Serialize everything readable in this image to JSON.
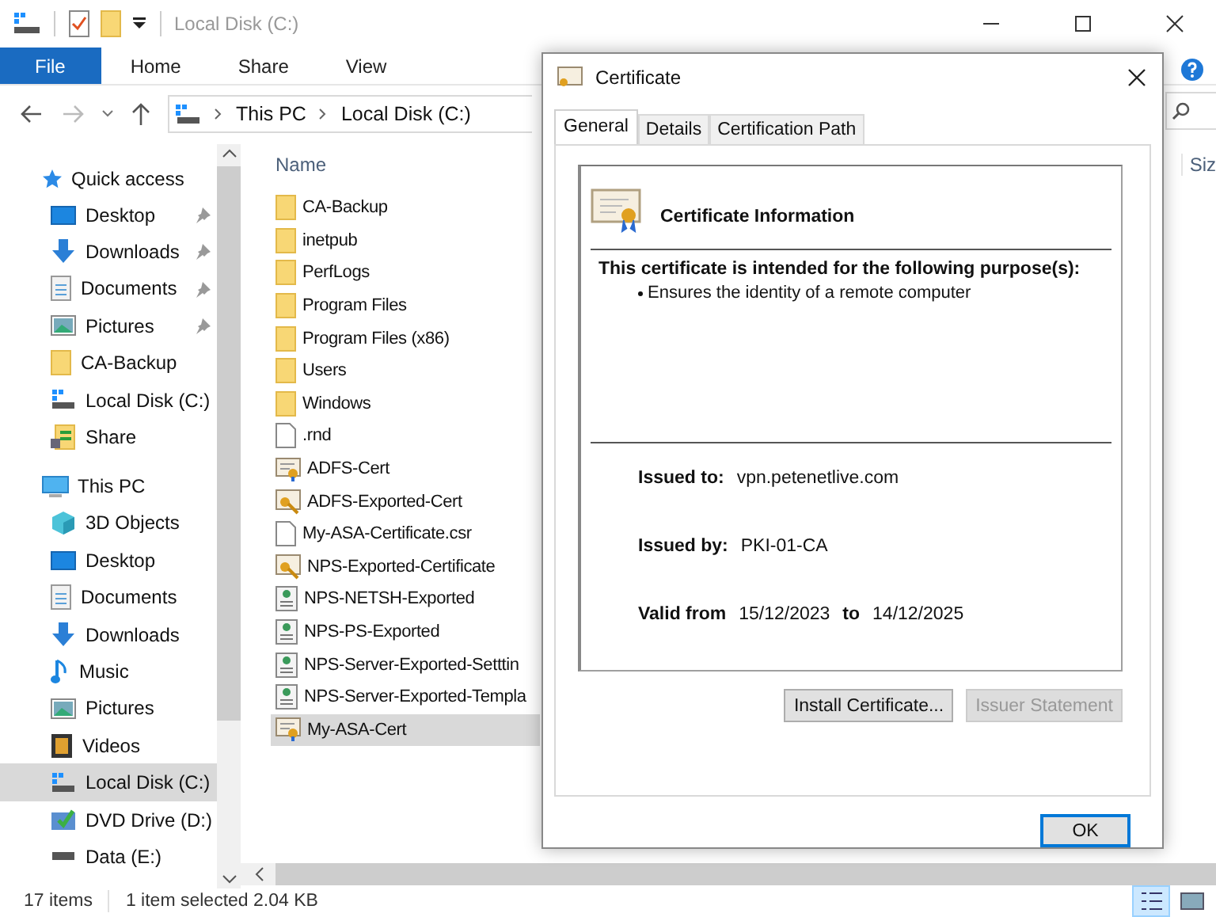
{
  "window": {
    "title": "Local Disk (C:)"
  },
  "ribbon_tabs": [
    {
      "label": "File",
      "selected": true
    },
    {
      "label": "Home",
      "selected": false
    },
    {
      "label": "Share",
      "selected": false
    },
    {
      "label": "View",
      "selected": false
    }
  ],
  "address": {
    "crumbs": [
      "This PC",
      "Local Disk (C:)"
    ]
  },
  "nav": [
    {
      "label": "Quick access",
      "kind": "star",
      "selected": false,
      "children": [
        {
          "label": "Desktop",
          "kind": "desktop",
          "pinned": true,
          "selected": false
        },
        {
          "label": "Downloads",
          "kind": "download",
          "pinned": true,
          "selected": false
        },
        {
          "label": "Documents",
          "kind": "document",
          "pinned": true,
          "selected": false
        },
        {
          "label": "Pictures",
          "kind": "pictures",
          "pinned": true,
          "selected": false
        },
        {
          "label": "CA-Backup",
          "kind": "folder",
          "pinned": false,
          "selected": false
        },
        {
          "label": "Local Disk (C:)",
          "kind": "drive",
          "pinned": false,
          "selected": false
        },
        {
          "label": "Share",
          "kind": "share",
          "pinned": false,
          "selected": false
        }
      ]
    },
    {
      "label": "This PC",
      "kind": "pc",
      "selected": false,
      "children": [
        {
          "label": "3D Objects",
          "kind": "cube",
          "pinned": false,
          "selected": false
        },
        {
          "label": "Desktop",
          "kind": "desktop",
          "pinned": false,
          "selected": false
        },
        {
          "label": "Documents",
          "kind": "document",
          "pinned": false,
          "selected": false
        },
        {
          "label": "Downloads",
          "kind": "download",
          "pinned": false,
          "selected": false
        },
        {
          "label": "Music",
          "kind": "music",
          "pinned": false,
          "selected": false
        },
        {
          "label": "Pictures",
          "kind": "pictures",
          "pinned": false,
          "selected": false
        },
        {
          "label": "Videos",
          "kind": "videos",
          "pinned": false,
          "selected": false
        },
        {
          "label": "Local Disk (C:)",
          "kind": "drive",
          "pinned": false,
          "selected": true
        },
        {
          "label": "DVD Drive (D:)",
          "kind": "dvd",
          "pinned": false,
          "selected": false
        },
        {
          "label": "Data (E:)",
          "kind": "disk",
          "pinned": false,
          "selected": false
        }
      ]
    }
  ],
  "file_list": {
    "columns": [
      "Name",
      "Siz"
    ],
    "rows": [
      {
        "name": "CA-Backup",
        "kind": "folder",
        "selected": false
      },
      {
        "name": "inetpub",
        "kind": "folder",
        "selected": false
      },
      {
        "name": "PerfLogs",
        "kind": "folder",
        "selected": false
      },
      {
        "name": "Program Files",
        "kind": "folder",
        "selected": false
      },
      {
        "name": "Program Files (x86)",
        "kind": "folder",
        "selected": false
      },
      {
        "name": "Users",
        "kind": "folder",
        "selected": false
      },
      {
        "name": "Windows",
        "kind": "folder",
        "selected": false
      },
      {
        "name": ".rnd",
        "kind": "file",
        "selected": false
      },
      {
        "name": "ADFS-Cert",
        "kind": "cert",
        "selected": false
      },
      {
        "name": "ADFS-Exported-Cert",
        "kind": "certkey",
        "selected": false
      },
      {
        "name": "My-ASA-Certificate.csr",
        "kind": "file",
        "selected": false
      },
      {
        "name": "NPS-Exported-Certificate",
        "kind": "certkey",
        "selected": false
      },
      {
        "name": "NPS-NETSH-Exported",
        "kind": "settings",
        "selected": false
      },
      {
        "name": "NPS-PS-Exported",
        "kind": "settings",
        "selected": false
      },
      {
        "name": "NPS-Server-Exported-Setttin",
        "kind": "settings",
        "selected": false
      },
      {
        "name": "NPS-Server-Exported-Templa",
        "kind": "settings",
        "selected": false
      },
      {
        "name": "My-ASA-Cert",
        "kind": "cert",
        "selected": true
      }
    ]
  },
  "status_bar": {
    "count": "17 items",
    "selection": "1 item selected  2.04 KB"
  },
  "dialog": {
    "title": "Certificate",
    "tabs": [
      {
        "label": "General",
        "selected": true
      },
      {
        "label": "Details",
        "selected": false
      },
      {
        "label": "Certification Path",
        "selected": false
      }
    ],
    "heading": "Certificate Information",
    "purpose_title": "This certificate is intended for the following purpose(s):",
    "purposes": [
      "Ensures the identity of a remote computer"
    ],
    "issued_to_label": "Issued to:",
    "issued_to": "vpn.petenetlive.com",
    "issued_by_label": "Issued by:",
    "issued_by": "PKI-01-CA",
    "valid_from_label": "Valid from",
    "valid_from": "15/12/2023",
    "to_label": "to",
    "valid_to": "14/12/2025",
    "buttons": [
      {
        "label": "Install Certificate...",
        "disabled": false
      },
      {
        "label": "Issuer Statement",
        "disabled": true
      }
    ],
    "ok": "OK"
  }
}
